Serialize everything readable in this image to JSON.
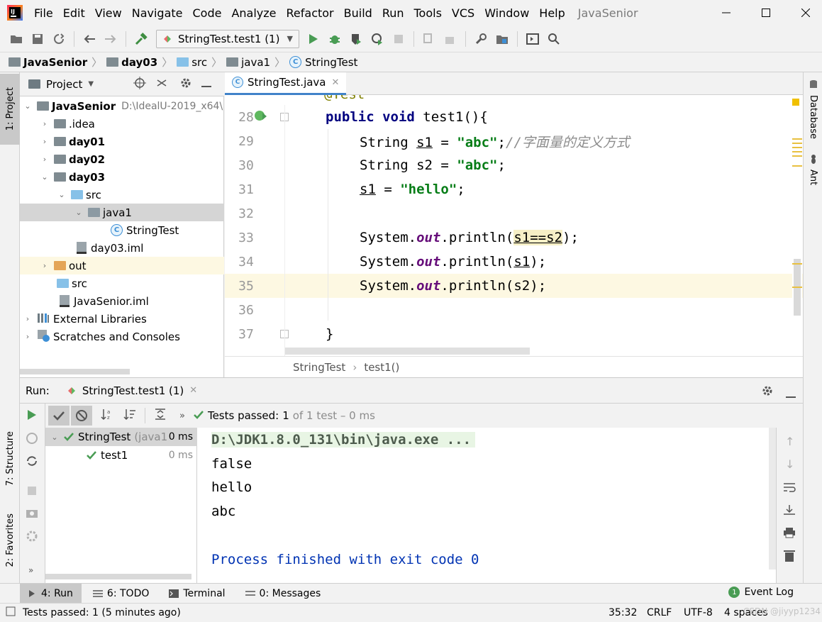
{
  "app": {
    "project_name": "JavaSenior"
  },
  "menu": [
    "File",
    "Edit",
    "View",
    "Navigate",
    "Code",
    "Analyze",
    "Refactor",
    "Build",
    "Run",
    "Tools",
    "VCS",
    "Window",
    "Help"
  ],
  "toolbar": {
    "run_config": "StringTest.test1 (1)"
  },
  "breadcrumb": [
    "JavaSenior",
    "day03",
    "src",
    "java1",
    "StringTest"
  ],
  "project_panel": {
    "title": "Project",
    "tree": [
      {
        "label": "JavaSenior",
        "path": "D:\\IdealU-2019_x64\\",
        "bold": true
      },
      {
        "label": ".idea"
      },
      {
        "label": "day01",
        "bold": true
      },
      {
        "label": "day02",
        "bold": true
      },
      {
        "label": "day03",
        "bold": true
      },
      {
        "label": "src"
      },
      {
        "label": "java1"
      },
      {
        "label": "StringTest"
      },
      {
        "label": "day03.iml"
      },
      {
        "label": "out"
      },
      {
        "label": "src"
      },
      {
        "label": "JavaSenior.iml"
      },
      {
        "label": "External Libraries"
      },
      {
        "label": "Scratches and Consoles"
      }
    ]
  },
  "editor": {
    "tab": "StringTest.java",
    "lines": [
      {
        "num": "28"
      },
      {
        "num": "29"
      },
      {
        "num": "30"
      },
      {
        "num": "31"
      },
      {
        "num": "32"
      },
      {
        "num": "33"
      },
      {
        "num": "34"
      },
      {
        "num": "35"
      },
      {
        "num": "36"
      },
      {
        "num": "37"
      }
    ],
    "code": {
      "l28_kw": "public void ",
      "l28_rest": "test1(){",
      "l29_a": "String ",
      "l29_var": "s1",
      "l29_b": " = ",
      "l29_str": "\"abc\"",
      "l29_semi": ";",
      "l29_cmt": "//字面量的定义方式",
      "l30_a": "String s2 = ",
      "l30_str": "\"abc\"",
      "l30_semi": ";",
      "l31_var": "s1",
      "l31_b": " = ",
      "l31_str": "\"hello\"",
      "l31_semi": ";",
      "sys": "System.",
      "out": "out",
      "println": ".println(",
      "l33_arg": "s1==s2",
      "l34_arg": "s1",
      "l35_arg": "s2",
      "close": ");",
      "l37": "}"
    },
    "status_crumb": [
      "StringTest",
      "test1()"
    ]
  },
  "right_tools": [
    "Database",
    "Ant"
  ],
  "left_tools": [
    "1: Project",
    "7: Structure",
    "2: Favorites"
  ],
  "run_panel": {
    "label": "Run:",
    "tab": "StringTest.test1 (1)",
    "tests_passed_label": "Tests passed:",
    "tests_passed_count": "1",
    "tests_passed_detail": "of 1 test – 0 ms",
    "test_tree": [
      {
        "label": "StringTest",
        "sub": "(java1",
        "time": "0 ms"
      },
      {
        "label": "test1",
        "time": "0 ms"
      }
    ],
    "console": [
      "D:\\JDK1.8.0_131\\bin\\java.exe ...",
      "false",
      "hello",
      "abc",
      "",
      "Process finished with exit code 0"
    ]
  },
  "bottom_tabs": [
    "4: Run",
    "6: TODO",
    "Terminal",
    "0: Messages"
  ],
  "event_log": "Event Log",
  "status": {
    "message": "Tests passed: 1 (5 minutes ago)",
    "position": "35:32",
    "line_sep": "CRLF",
    "encoding": "UTF-8",
    "indent": "4 spaces",
    "watermark": "CSDN @jiyyp1234"
  }
}
